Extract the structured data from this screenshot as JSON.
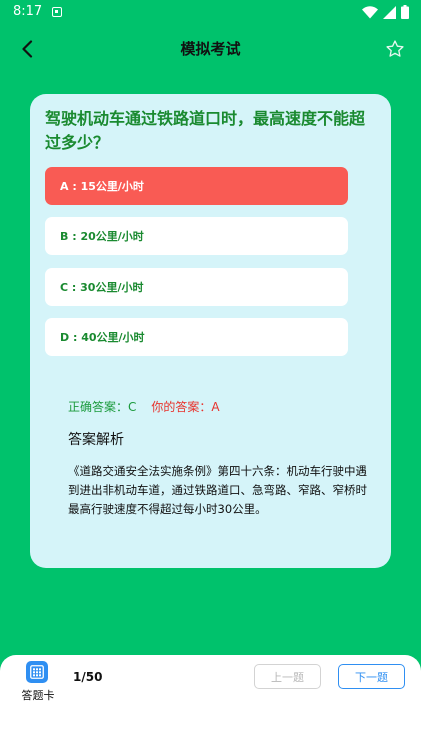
{
  "status_bar": {
    "time": "8:17"
  },
  "header": {
    "title": "模拟考试"
  },
  "question": {
    "text": "驾驶机动车通过铁路道口时，最高速度不能超过多少？",
    "options": [
      {
        "label": "A : 15公里/小时",
        "state": "selected-wrong"
      },
      {
        "label": "B : 20公里/小时",
        "state": "normal"
      },
      {
        "label": "C : 30公里/小时",
        "state": "normal"
      },
      {
        "label": "D : 40公里/小时",
        "state": "normal"
      }
    ]
  },
  "answer": {
    "correct": "正确答案：C",
    "mine": "你的答案：A"
  },
  "analysis": {
    "title": "答案解析",
    "body": "《道路交通安全法实施条例》第四十六条：机动车行驶中遇到进出非机动车道，通过铁路道口、急弯路、窄路、窄桥时最高行驶速度不得超过每小时30公里。"
  },
  "bottom_bar": {
    "answer_card_label": "答题卡",
    "progress": "1/50",
    "prev_label": "上一题",
    "next_label": "下一题"
  },
  "colors": {
    "background": "#00c26c",
    "card": "#d5f4f9",
    "question_text": "#1a8a30",
    "wrong_option": "#f95b54",
    "correct_answer": "#1a9a3c",
    "my_answer": "#e8322c",
    "accent_blue": "#2f8ff2"
  },
  "icons": {
    "back": "back-arrow-icon",
    "favorite": "star-outline-icon",
    "answer_card": "grid-card-icon",
    "notification": "notification-icon",
    "wifi": "wifi-icon",
    "signal": "signal-icon",
    "battery": "battery-icon"
  }
}
